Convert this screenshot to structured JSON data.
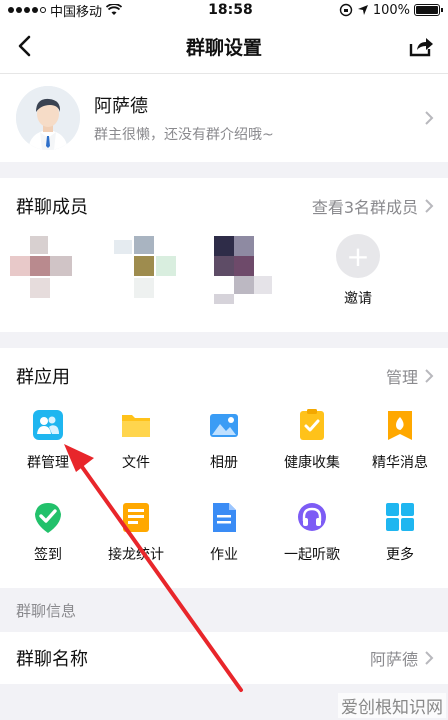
{
  "status_bar": {
    "carrier": "中国移动",
    "time": "18:58",
    "battery": "100%"
  },
  "nav": {
    "title": "群聊设置"
  },
  "profile": {
    "name": "阿萨德",
    "subtitle": "群主很懒，还没有群介绍哦~"
  },
  "members": {
    "title": "群聊成员",
    "view_all": "查看3名群成员",
    "invite_label": "邀请",
    "invite_symbol": "+"
  },
  "apps": {
    "title": "群应用",
    "manage_label": "管理",
    "items": [
      {
        "label": "群管理",
        "icon": "group-manage-icon",
        "color": "#1fb6f0"
      },
      {
        "label": "文件",
        "icon": "folder-icon",
        "color": "#ffc21a"
      },
      {
        "label": "相册",
        "icon": "photo-album-icon",
        "color": "#3a9cf5"
      },
      {
        "label": "健康收集",
        "icon": "health-collect-icon",
        "color": "#ffc21a"
      },
      {
        "label": "精华消息",
        "icon": "essence-message-icon",
        "color": "#ffa800"
      },
      {
        "label": "签到",
        "icon": "check-in-icon",
        "color": "#22c16b"
      },
      {
        "label": "接龙统计",
        "icon": "relay-stats-icon",
        "color": "#ffa800"
      },
      {
        "label": "作业",
        "icon": "homework-icon",
        "color": "#3a8cf5"
      },
      {
        "label": "一起听歌",
        "icon": "listen-together-icon",
        "color": "#7d5cf5"
      },
      {
        "label": "更多",
        "icon": "more-apps-icon",
        "color": "#1fb6f0"
      }
    ]
  },
  "info": {
    "section_label": "群聊信息",
    "name_label": "群聊名称",
    "name_value": "阿萨德"
  },
  "watermark": "爱创根知识网",
  "colors": {
    "annotation_arrow": "#e8262b"
  }
}
